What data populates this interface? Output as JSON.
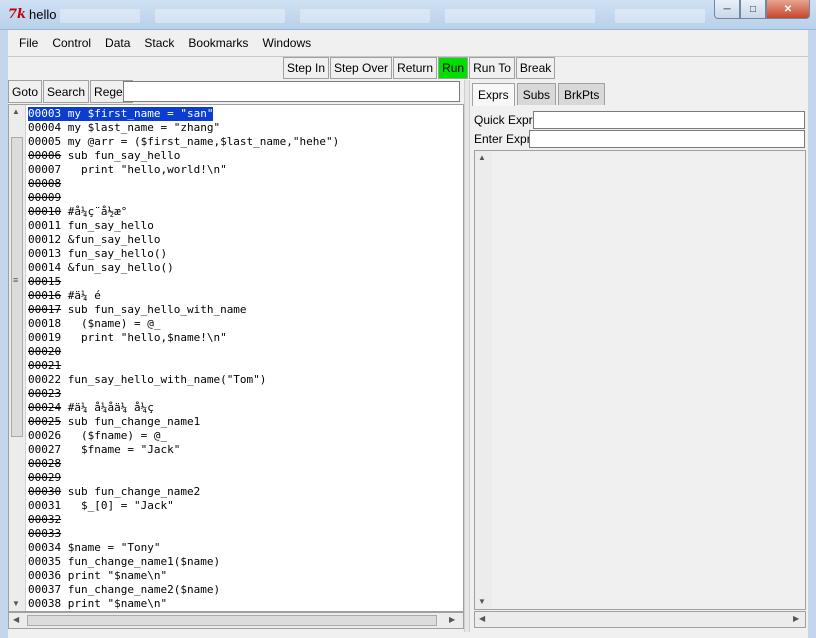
{
  "window": {
    "title": "hello",
    "app_icon": "7k"
  },
  "menu": [
    "File",
    "Control",
    "Data",
    "Stack",
    "Bookmarks",
    "Windows"
  ],
  "toolbar": [
    "Step In",
    "Step Over",
    "Return",
    "Run",
    "Run To",
    "Break"
  ],
  "left": {
    "buttons": [
      "Goto",
      "Search",
      "Regex"
    ]
  },
  "code_lines": [
    {
      "ln": "00003",
      "text": " my $first_name = \"san\"",
      "strike": false,
      "sel": true
    },
    {
      "ln": "00004",
      "text": " my $last_name = \"zhang\"",
      "strike": false
    },
    {
      "ln": "00005",
      "text": " my @arr = ($first_name,$last_name,\"hehe\")",
      "strike": false
    },
    {
      "ln": "00006",
      "text": " sub fun_say_hello",
      "strike": true
    },
    {
      "ln": "00007",
      "text": "   print \"hello,world!\\n\"",
      "strike": false
    },
    {
      "ln": "00008",
      "text": "",
      "strike": true
    },
    {
      "ln": "00009",
      "text": "",
      "strike": true
    },
    {
      "ln": "00010",
      "text": " #å¼ç¨å½æ°",
      "strike": true
    },
    {
      "ln": "00011",
      "text": " fun_say_hello",
      "strike": false
    },
    {
      "ln": "00012",
      "text": " &fun_say_hello",
      "strike": false
    },
    {
      "ln": "00013",
      "text": " fun_say_hello()",
      "strike": false
    },
    {
      "ln": "00014",
      "text": " &fun_say_hello()",
      "strike": false
    },
    {
      "ln": "00015",
      "text": "",
      "strike": true
    },
    {
      "ln": "00016",
      "text": " #ä¼ é",
      "strike": true
    },
    {
      "ln": "00017",
      "text": " sub fun_say_hello_with_name",
      "strike": true
    },
    {
      "ln": "00018",
      "text": "   ($name) = @_",
      "strike": false
    },
    {
      "ln": "00019",
      "text": "   print \"hello,$name!\\n\"",
      "strike": false
    },
    {
      "ln": "00020",
      "text": "",
      "strike": true
    },
    {
      "ln": "00021",
      "text": "",
      "strike": true
    },
    {
      "ln": "00022",
      "text": " fun_say_hello_with_name(\"Tom\")",
      "strike": false
    },
    {
      "ln": "00023",
      "text": "",
      "strike": true
    },
    {
      "ln": "00024",
      "text": " #ä¼ å¼åä¼ å¼ç",
      "strike": true
    },
    {
      "ln": "00025",
      "text": " sub fun_change_name1",
      "strike": true
    },
    {
      "ln": "00026",
      "text": "   ($fname) = @_",
      "strike": false
    },
    {
      "ln": "00027",
      "text": "   $fname = \"Jack\"",
      "strike": false
    },
    {
      "ln": "00028",
      "text": "",
      "strike": true
    },
    {
      "ln": "00029",
      "text": "",
      "strike": true
    },
    {
      "ln": "00030",
      "text": " sub fun_change_name2",
      "strike": true
    },
    {
      "ln": "00031",
      "text": "   $_[0] = \"Jack\"",
      "strike": false
    },
    {
      "ln": "00032",
      "text": "",
      "strike": true
    },
    {
      "ln": "00033",
      "text": "",
      "strike": true
    },
    {
      "ln": "00034",
      "text": " $name = \"Tony\"",
      "strike": false
    },
    {
      "ln": "00035",
      "text": " fun_change_name1($name)",
      "strike": false
    },
    {
      "ln": "00036",
      "text": " print \"$name\\n\"",
      "strike": false
    },
    {
      "ln": "00037",
      "text": " fun_change_name2($name)",
      "strike": false
    },
    {
      "ln": "00038",
      "text": " print \"$name\\n\"",
      "strike": false
    }
  ],
  "right": {
    "tabs": [
      "Exprs",
      "Subs",
      "BrkPts"
    ],
    "active_tab": "Exprs",
    "quick_expr_label": "Quick Expr:",
    "quick_expr_value": "",
    "enter_expr_label": "Enter Expr:",
    "enter_expr_value": ""
  },
  "colors": {
    "selection": "#0b3dd1",
    "run_button": "#00e000",
    "close_button": "#c7462a"
  }
}
